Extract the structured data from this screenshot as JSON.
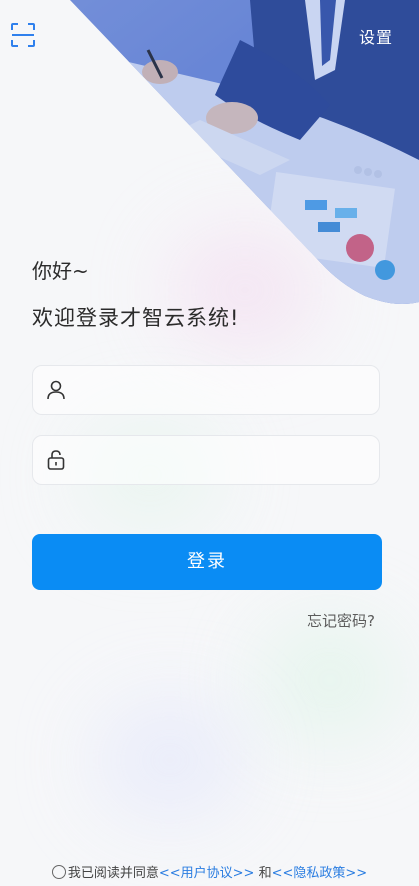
{
  "header": {
    "scan_icon": "scan-icon",
    "settings_label": "设置"
  },
  "greeting": "你好~",
  "welcome": "欢迎登录才智云系统!",
  "form": {
    "username": {
      "value": "",
      "placeholder": "",
      "icon": "user-icon"
    },
    "password": {
      "value": "",
      "placeholder": "",
      "icon": "lock-icon"
    },
    "login_label": "登录",
    "forgot_label": "忘记密码?"
  },
  "agreement": {
    "prefix": "我已阅读并同意",
    "user_agreement": "<<用户协议>>",
    "and": " 和",
    "privacy_policy": "<<隐私政策>>"
  },
  "colors": {
    "primary": "#0a8cf4",
    "link": "#2a7de1",
    "hero_tint": "#5b7fd6"
  }
}
